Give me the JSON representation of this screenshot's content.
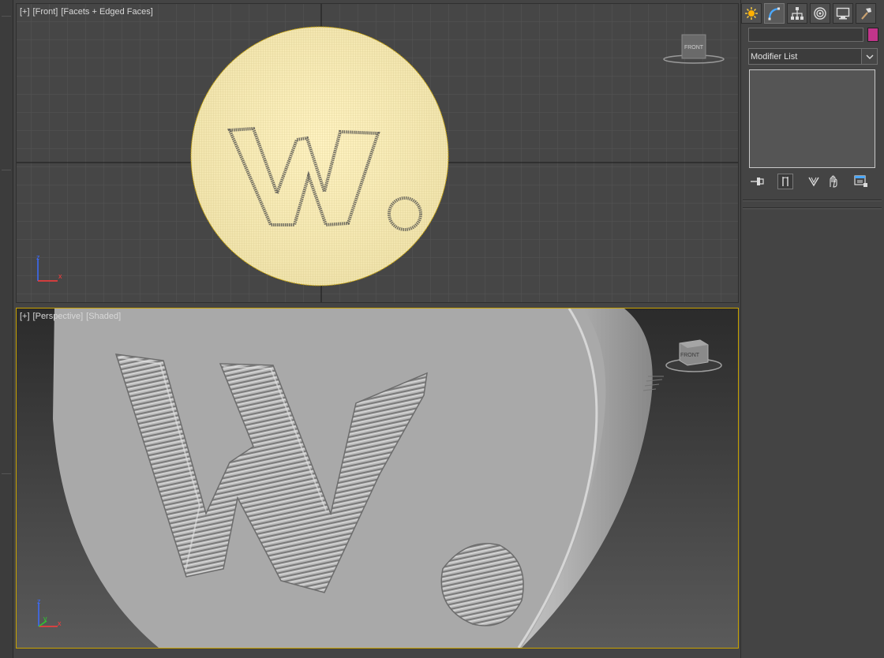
{
  "viewports": {
    "front": {
      "plus": "[+]",
      "view": "[Front]",
      "shading": "[Facets + Edged Faces]",
      "viewcube_label": "FRONT",
      "axes": [
        "z",
        "x"
      ]
    },
    "perspective": {
      "plus": "[+]",
      "view": "[Perspective]",
      "shading": "[Shaded]",
      "viewcube_label": "FRONT",
      "axes": [
        "z",
        "y",
        "x"
      ]
    }
  },
  "command_panel": {
    "tabs": [
      {
        "icon": "create-icon"
      },
      {
        "icon": "modify-icon",
        "active": true
      },
      {
        "icon": "hierarchy-icon"
      },
      {
        "icon": "motion-icon"
      },
      {
        "icon": "display-icon"
      },
      {
        "icon": "utilities-icon"
      }
    ],
    "object_name": "",
    "object_color": "#c2358b",
    "modifier_list_label": "Modifier List",
    "stack_tools": [
      "pin-stack-icon",
      "show-end-result-icon",
      "make-unique-icon",
      "remove-modifier-icon",
      "configure-modifier-sets-icon"
    ]
  },
  "colors": {
    "selection_outline": "#c8a200",
    "mesh_fill": "#f2e4ad",
    "grid_line": "#555555",
    "axis_z": "#3b6cff",
    "axis_x": "#ff3b3b",
    "axis_y": "#2ec92e"
  }
}
